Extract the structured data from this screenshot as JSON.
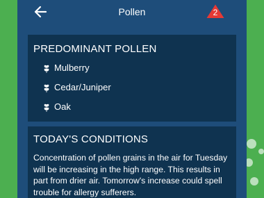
{
  "header": {
    "title": "Pollen",
    "alert_count": "2"
  },
  "predominant": {
    "heading": "PREDOMINANT POLLEN",
    "items": [
      {
        "label": "Mulberry",
        "icon": "flower-icon"
      },
      {
        "label": "Cedar/Juniper",
        "icon": "flower-icon"
      },
      {
        "label": "Oak",
        "icon": "flower-icon"
      }
    ]
  },
  "conditions": {
    "heading": "TODAY'S CONDITIONS",
    "text": "Concentration of pollen grains in the air for Tuesday will be increasing in the high range. This results in part from drier air. Tomorrow's increase could spell trouble for allergy sufferers."
  },
  "colors": {
    "app_bg": "#1e4d7a",
    "card_bg": "#0f3350",
    "alert": "#e53935",
    "outer_bg": "#4caf50"
  }
}
